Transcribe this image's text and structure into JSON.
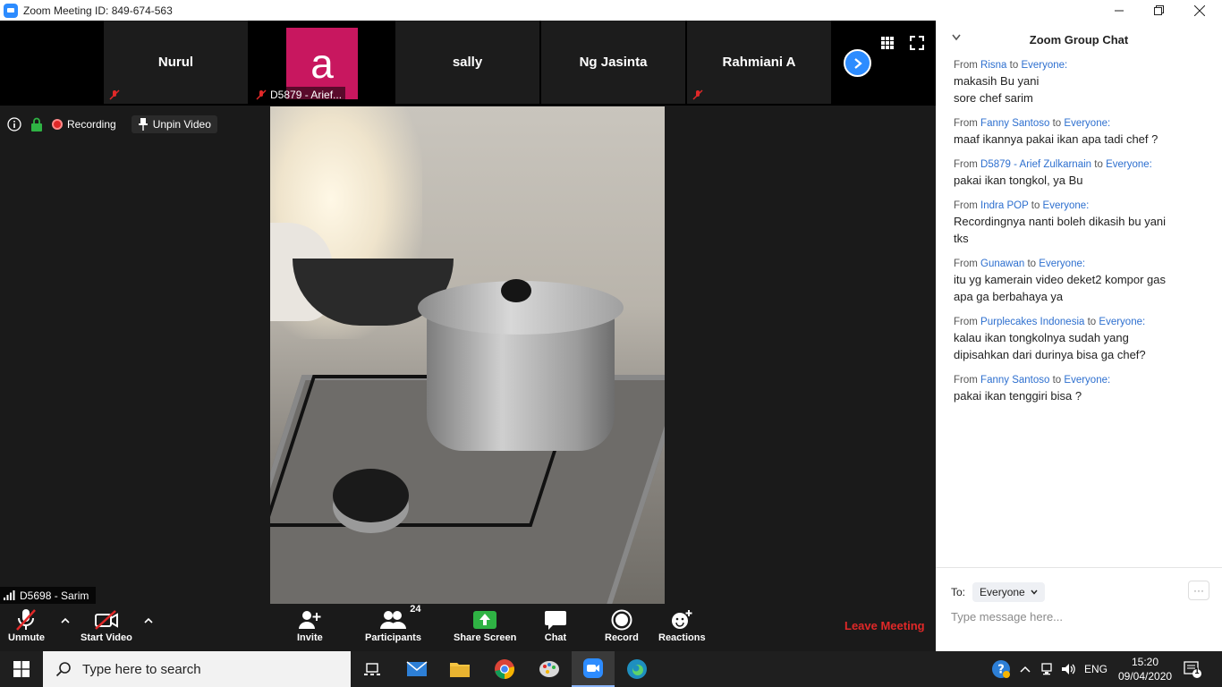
{
  "window": {
    "title": "Zoom Meeting ID: 849-674-563"
  },
  "strip": {
    "participants": [
      {
        "name": "Nurul"
      },
      {
        "name": "D5879 - Arief...",
        "avatar_letter": "a"
      },
      {
        "name": "sally"
      },
      {
        "name": "Ng Jasinta"
      },
      {
        "name": "Rahmiani A"
      }
    ]
  },
  "info_bar": {
    "recording": "Recording",
    "unpin": "Unpin Video"
  },
  "active_speaker": {
    "name": "D5698 - Sarim"
  },
  "toolbar": {
    "unmute": "Unmute",
    "start_video": "Start Video",
    "invite": "Invite",
    "participants": "Participants",
    "participants_count": "24",
    "share_screen": "Share Screen",
    "chat": "Chat",
    "record": "Record",
    "reactions": "Reactions",
    "leave": "Leave Meeting"
  },
  "chat": {
    "title": "Zoom Group Chat",
    "from_word": "From",
    "to_word": "to",
    "messages": [
      {
        "from": "Risna",
        "to": "Everyone:",
        "lines": [
          "makasih Bu yani",
          "sore chef sarim"
        ]
      },
      {
        "from": "Fanny Santoso",
        "to": "Everyone:",
        "lines": [
          "maaf ikannya pakai ikan apa tadi chef ?"
        ]
      },
      {
        "from": "D5879 - Arief Zulkarnain",
        "to": "Everyone:",
        "lines": [
          "pakai ikan tongkol, ya Bu"
        ]
      },
      {
        "from": "Indra POP",
        "to": "Everyone:",
        "lines": [
          "Recordingnya nanti boleh dikasih bu yani",
          "tks"
        ]
      },
      {
        "from": "Gunawan",
        "to": "Everyone:",
        "lines": [
          "itu yg kamerain video deket2 kompor gas",
          "apa ga berbahaya ya"
        ]
      },
      {
        "from": "Purplecakes Indonesia",
        "to": "Everyone:",
        "lines": [
          "kalau ikan tongkolnya sudah  yang",
          "dipisahkan dari durinya bisa ga chef?"
        ]
      },
      {
        "from": "Fanny Santoso",
        "to": "Everyone:",
        "lines": [
          "pakai ikan tenggiri bisa ?"
        ]
      }
    ],
    "to_label": "To:",
    "to_value": "Everyone",
    "input_placeholder": "Type message here..."
  },
  "taskbar": {
    "search_placeholder": "Type here to search",
    "language": "ENG",
    "time": "15:20",
    "date": "09/04/2020",
    "notification_count": "1"
  },
  "colors": {
    "zoom_blue": "#2d8cff",
    "leave_red": "#e02828",
    "avatar_pink": "#c8175f"
  }
}
